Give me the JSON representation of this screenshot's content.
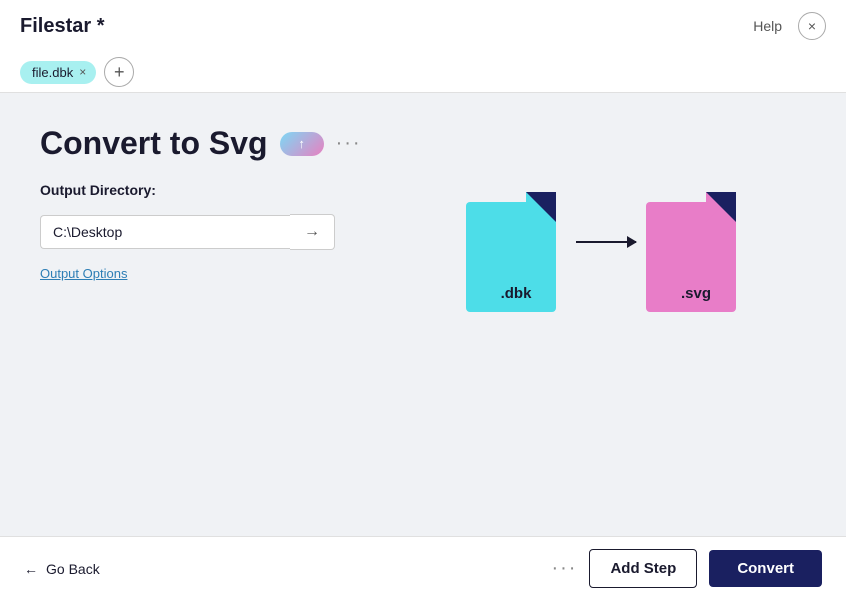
{
  "app": {
    "title": "Filestar *",
    "help_label": "Help",
    "close_label": "×"
  },
  "tabs": {
    "file_tag": "file.dbk",
    "add_tab_label": "+"
  },
  "main": {
    "page_title": "Convert to Svg",
    "more_dots": "···",
    "output_dir_label": "Output Directory:",
    "output_dir_value": "C:\\Desktop",
    "output_options_label": "Output Options",
    "browse_arrow": "→"
  },
  "conversion": {
    "source_label": ".dbk",
    "target_label": ".svg"
  },
  "footer": {
    "go_back_label": "Go Back",
    "more_dots": "···",
    "add_step_label": "Add Step",
    "convert_label": "Convert"
  }
}
